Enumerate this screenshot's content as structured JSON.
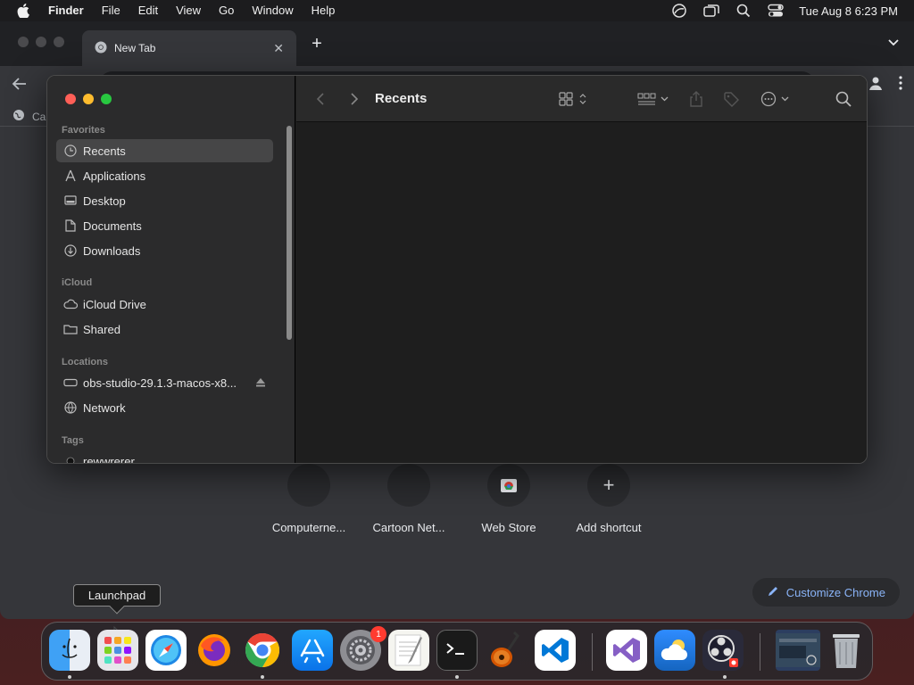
{
  "menubar": {
    "app_name": "Finder",
    "items": [
      "File",
      "Edit",
      "View",
      "Go",
      "Window",
      "Help"
    ],
    "clock": "Tue Aug 8  6:23 PM"
  },
  "chrome": {
    "tab_title": "New Tab",
    "tab_close": "✕",
    "new_tab": "+",
    "bookmark_label": "Ca",
    "shortcuts": [
      {
        "label": "Computerne..."
      },
      {
        "label": "Cartoon Net..."
      },
      {
        "label": "Web Store"
      },
      {
        "label": "Add shortcut",
        "icon": "+"
      }
    ],
    "customize_label": "Customize Chrome"
  },
  "finder": {
    "title": "Recents",
    "favorites_title": "Favorites",
    "favorites": [
      {
        "label": "Recents",
        "icon": "clock-icon",
        "selected": true
      },
      {
        "label": "Applications",
        "icon": "applications-icon"
      },
      {
        "label": "Desktop",
        "icon": "desktop-icon"
      },
      {
        "label": "Documents",
        "icon": "document-icon"
      },
      {
        "label": "Downloads",
        "icon": "download-icon"
      }
    ],
    "icloud_title": "iCloud",
    "icloud": [
      {
        "label": "iCloud Drive",
        "icon": "cloud-icon"
      },
      {
        "label": "Shared",
        "icon": "shared-folder-icon"
      }
    ],
    "locations_title": "Locations",
    "locations": [
      {
        "label": "obs-studio-29.1.3-macos-x8...",
        "icon": "disk-icon"
      },
      {
        "label": "Network",
        "icon": "network-icon"
      }
    ],
    "tags_title": "Tags",
    "tags": [
      {
        "label": "rewwrerer"
      }
    ]
  },
  "tooltip": "Launchpad",
  "dock": {
    "system_preferences_badge": "1",
    "apps": [
      "Finder",
      "Launchpad",
      "Safari",
      "Firefox",
      "Chrome",
      "App Store",
      "System Preferences",
      "TextEdit",
      "Terminal",
      "GarageBand",
      "VS Code",
      "Visual Studio",
      "Weather",
      "OBS",
      "Screenshot",
      "Trash"
    ]
  }
}
